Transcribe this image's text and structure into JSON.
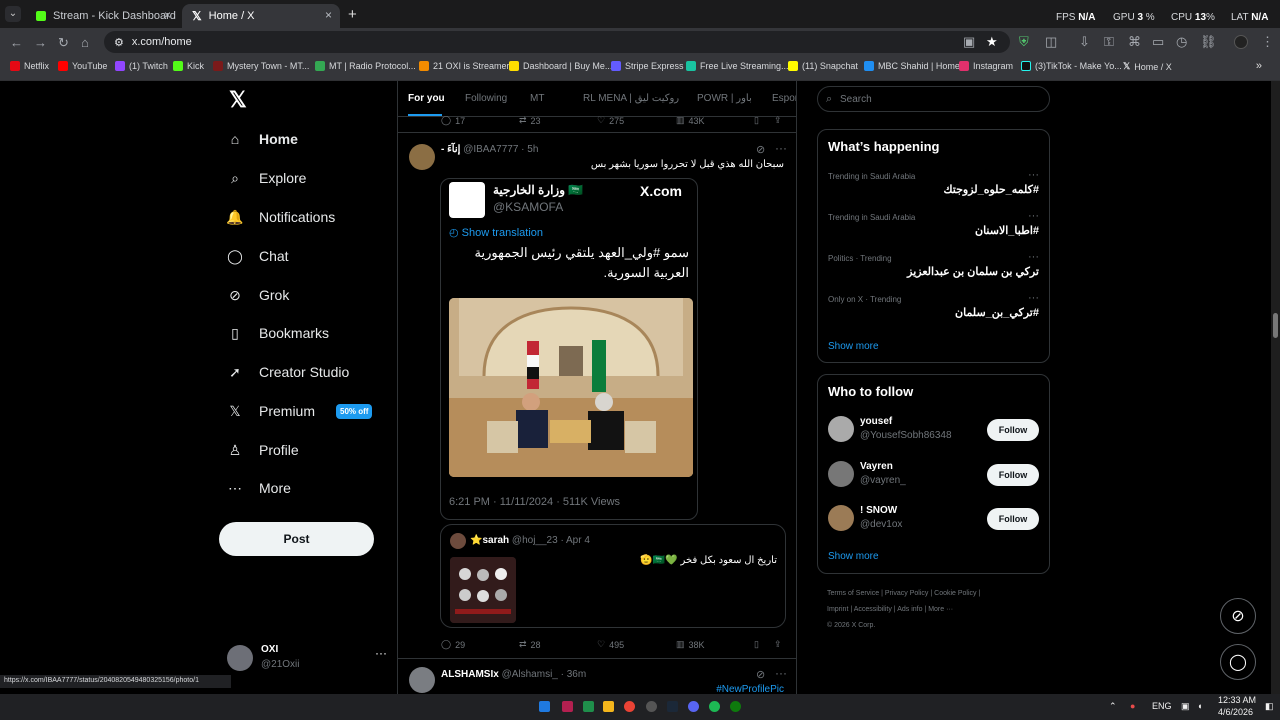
{
  "browser": {
    "tabs": [
      {
        "label": "Stream - Kick Dashboard",
        "icon": "kick-icon"
      },
      {
        "label": "Home / X",
        "icon": "x-icon"
      }
    ],
    "url": "x.com/home",
    "bookmarks": [
      "Netflix",
      "YouTube",
      "(1) Twitch",
      "Kick",
      "Mystery Town - MT...",
      "MT | Radio Protocol...",
      "21 OXI is Streamer",
      "Dashboard | Buy Me...",
      "Stripe Express",
      "Free Live Streaming...",
      "(11) Snapchat",
      "MBC Shahid | Home",
      "Instagram",
      "(3)TikTok - Make Yo...",
      "Home / X"
    ],
    "stats": {
      "fps_label": "FPS",
      "fps": "N/A",
      "gpu_label": "GPU",
      "gpu": "3",
      "gpu_unit": "%",
      "cpu_label": "CPU",
      "cpu": "13",
      "cpu_unit": "%",
      "lat_label": "LAT",
      "lat": "N/A"
    },
    "status_url": "https://x.com/IBAA7777/status/2040820549480325156/photo/1"
  },
  "left_nav": {
    "items": [
      "Home",
      "Explore",
      "Notifications",
      "Chat",
      "Grok",
      "Bookmarks",
      "Creator Studio",
      "Premium",
      "Profile",
      "More"
    ],
    "premium_badge": "50% off",
    "post_button": "Post",
    "account": {
      "name": "OXI",
      "handle": "@21Oxii"
    }
  },
  "feed": {
    "tabs": [
      "For you",
      "Following",
      "MT",
      "RL MENA | روكيت ليق",
      "POWR | باور",
      "Espor"
    ],
    "top_metrics": {
      "replies": "17",
      "reposts": "23",
      "likes": "275",
      "views": "43K"
    },
    "tweet1": {
      "name": "- إنآءَ",
      "handle": "@IBAA7777",
      "time": "5h",
      "text": "سبحان الله هذي قبل لا تحرروا سوريا بشهر بس"
    },
    "quote1": {
      "name": "وزارة الخارجية 🇸🇦",
      "handle": "@KSAMOFA",
      "site": "X.com",
      "translation": "Show translation",
      "text": "سمو #ولي_العهد يلتقي رئيس الجمهورية العربية السورية.",
      "meta": "6:21 PM · 11/11/2024 · 511K Views"
    },
    "quote2": {
      "name": "⭐sarah",
      "handle": "@hoj__23",
      "time": "Apr 4",
      "text": "تاريخ ال سعود بكل فخر 💚🇸🇦🫡"
    },
    "metrics2": {
      "replies": "29",
      "reposts": "28",
      "likes": "495",
      "views": "38K"
    },
    "next": {
      "name": "ALSHAMSIx",
      "handle": "@Alshamsi_",
      "time": "36m",
      "hashtag": "#NewProfilePic"
    }
  },
  "right": {
    "search": "Search",
    "whats_happening": "What’s happening",
    "trends": [
      {
        "meta": "Trending in Saudi Arabia",
        "title": "#كلمه_حلوه_لزوجتك"
      },
      {
        "meta": "Trending in Saudi Arabia",
        "title": "#اطبا_الاسنان"
      },
      {
        "meta": "Politics · Trending",
        "title": "تركي بن سلمان بن عبدالعزيز"
      },
      {
        "meta": "Only on X · Trending",
        "title": "#تركي_بن_سلمان"
      }
    ],
    "show_more": "Show more",
    "who_to_follow": "Who to follow",
    "follows": [
      {
        "name": "yousef",
        "handle": "@YousefSobh86348",
        "button": "Follow"
      },
      {
        "name": "Vayren",
        "handle": "@vayren_",
        "button": "Follow"
      },
      {
        "name": "! SNOW",
        "handle": "@dev1ox",
        "button": "Follow"
      }
    ],
    "footer": [
      "Terms of Service",
      "Privacy Policy",
      "Cookie Policy",
      "Imprint",
      "Accessibility",
      "Ads info",
      "More ···",
      "© 2026 X Corp."
    ]
  },
  "taskbar": {
    "lang": "ENG",
    "time": "12:33 AM",
    "date": "4/6/2026"
  },
  "colors": {
    "accent": "#1d9bf0",
    "bg": "#000000",
    "chrome": "#202124"
  }
}
